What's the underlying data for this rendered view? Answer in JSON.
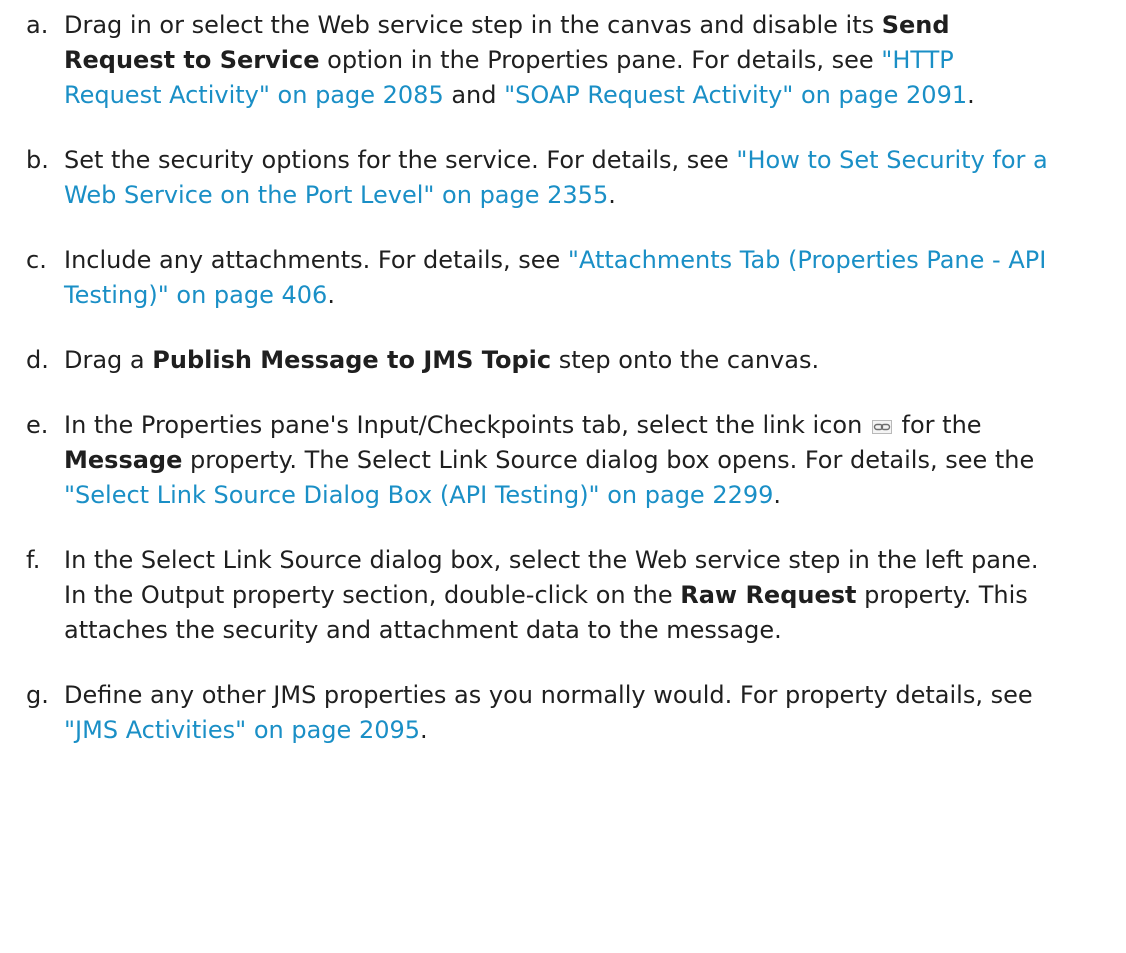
{
  "steps": [
    {
      "marker": "a.",
      "parts": [
        {
          "t": "text",
          "v": "Drag in or select the Web service step in the canvas and disable its "
        },
        {
          "t": "bold",
          "v": "Send Request to Service"
        },
        {
          "t": "text",
          "v": " option in the Properties pane. For details, see "
        },
        {
          "t": "link",
          "v": "\"HTTP Request Activity\" on page 2085"
        },
        {
          "t": "text",
          "v": " and "
        },
        {
          "t": "link",
          "v": "\"SOAP Request Activity\" on page 2091"
        },
        {
          "t": "text",
          "v": "."
        }
      ]
    },
    {
      "marker": "b.",
      "parts": [
        {
          "t": "text",
          "v": "Set the security options for the service. For details, see "
        },
        {
          "t": "link",
          "v": "\"How to Set Security for a Web Service on the Port Level\" on page 2355"
        },
        {
          "t": "text",
          "v": "."
        }
      ]
    },
    {
      "marker": "c.",
      "parts": [
        {
          "t": "text",
          "v": "Include any attachments. For details, see "
        },
        {
          "t": "link",
          "v": "\"Attachments Tab (Properties Pane - API Testing)\" on page 406"
        },
        {
          "t": "text",
          "v": "."
        }
      ]
    },
    {
      "marker": "d.",
      "parts": [
        {
          "t": "text",
          "v": "Drag a "
        },
        {
          "t": "bold",
          "v": "Publish Message to JMS Topic"
        },
        {
          "t": "text",
          "v": " step onto the canvas."
        }
      ]
    },
    {
      "marker": "e.",
      "parts": [
        {
          "t": "text",
          "v": "In the Properties pane's Input/Checkpoints tab, select the link icon "
        },
        {
          "t": "icon",
          "v": "link-icon"
        },
        {
          "t": "text",
          "v": " for the "
        },
        {
          "t": "bold",
          "v": "Message"
        },
        {
          "t": "text",
          "v": " property. The Select Link Source dialog box opens. For details, see the "
        },
        {
          "t": "link",
          "v": "\"Select Link Source Dialog Box (API Testing)\" on page 2299"
        },
        {
          "t": "text",
          "v": "."
        }
      ]
    },
    {
      "marker": "f.",
      "parts": [
        {
          "t": "text",
          "v": "In the Select Link Source dialog box, select the Web service step in the left pane. In the Output property section, double-click on the "
        },
        {
          "t": "bold",
          "v": "Raw Request"
        },
        {
          "t": "text",
          "v": " property. This attaches the security and attachment data to the message."
        }
      ]
    },
    {
      "marker": "g.",
      "parts": [
        {
          "t": "text",
          "v": "Define any other JMS properties as you normally would. For property details, see "
        },
        {
          "t": "link",
          "v": "\"JMS Activities\" on page 2095"
        },
        {
          "t": "text",
          "v": "."
        }
      ]
    }
  ],
  "colors": {
    "link": "#1a8fc6",
    "text": "#1f1f1f"
  }
}
